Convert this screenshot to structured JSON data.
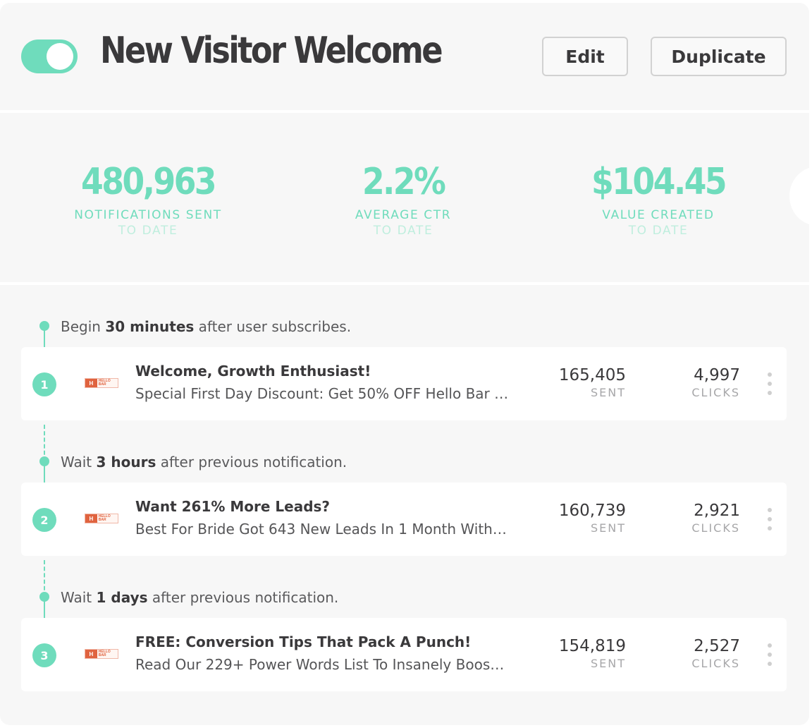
{
  "header": {
    "toggle_on": true,
    "title": "New Visitor Welcome",
    "edit_label": "Edit",
    "duplicate_label": "Duplicate"
  },
  "stats": [
    {
      "value": "480,963",
      "label": "NOTIFICATIONS SENT",
      "sublabel": "TO DATE"
    },
    {
      "value": "2.2%",
      "label": "AVERAGE CTR",
      "sublabel": "TO DATE"
    },
    {
      "value": "$104.45",
      "label": "VALUE CREATED",
      "sublabel": "TO DATE"
    }
  ],
  "steps": [
    {
      "delay_prefix": "Begin ",
      "delay_amount": "30 minutes",
      "delay_suffix": " after user subscribes.",
      "number": "1",
      "title": "Welcome, Growth Enthusiast!",
      "body": "Special First Day Discount: Get 50% OFF Hello Bar A...",
      "sent": "165,405",
      "sent_label": "SENT",
      "clicks": "4,997",
      "clicks_label": "CLICKS"
    },
    {
      "delay_prefix": "Wait ",
      "delay_amount": "3 hours",
      "delay_suffix": " after previous notification.",
      "number": "2",
      "title": "Want 261% More Leads?",
      "body": "Best For Bride Got 643 New Leads In 1 Month With H...",
      "sent": "160,739",
      "sent_label": "SENT",
      "clicks": "2,921",
      "clicks_label": "CLICKS"
    },
    {
      "delay_prefix": "Wait ",
      "delay_amount": "1 days",
      "delay_suffix": " after previous notification.",
      "number": "3",
      "title": "FREE: Conversion Tips That Pack A Punch!",
      "body": "Read Our 229+ Power Words List To Insanely Boost ...",
      "sent": "154,819",
      "sent_label": "SENT",
      "clicks": "2,527",
      "clicks_label": "CLICKS"
    }
  ],
  "logo_text": "HELLO BAR",
  "colors": {
    "accent": "#6fdcbc",
    "accent_light": "#bfeede",
    "logo": "#e0633f"
  }
}
